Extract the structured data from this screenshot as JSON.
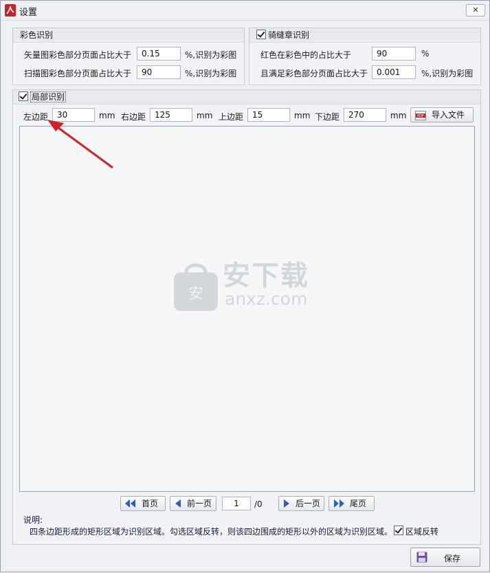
{
  "window": {
    "title": "设置",
    "close_label": "✕"
  },
  "color_recognition": {
    "header": "彩色识别",
    "vector_label": "矢量图彩色部分页面占比大于",
    "vector_value": "0.15",
    "vector_suffix": "%,识别为彩图",
    "scan_label": "扫描图彩色部分页面占比大于",
    "scan_value": "90",
    "scan_suffix": "%,识别为彩图"
  },
  "seal_recognition": {
    "header": "骑缝章识别",
    "red_label": "红色在彩色中的占比大于",
    "red_value": "90",
    "red_suffix": "%",
    "color_label": "且满足彩色部分页面占比大于",
    "color_value": "0.001",
    "color_suffix": "%,识别为彩图"
  },
  "local_recognition": {
    "header": "局部识别",
    "left_label": "左边距",
    "left_value": "30",
    "right_label": "右边距",
    "right_value": "125",
    "top_label": "上边距",
    "top_value": "15",
    "bottom_label": "下边距",
    "bottom_value": "270",
    "unit": "mm",
    "import_label": "导入文件"
  },
  "watermark": {
    "text": "安下载",
    "url": "anxz.com",
    "badge": "安"
  },
  "pager": {
    "first": "首页",
    "prev": "前一页",
    "page_value": "1",
    "total": "/0",
    "next": "后一页",
    "last": "尾页"
  },
  "note": {
    "title": "说明:",
    "text": "四条边距形成的矩形区域为识别区域。勾选区域反转，则该四边围成的矩形以外的区域为识别区域。",
    "invert_label": "区域反转"
  },
  "save_label": "保存",
  "colors": {
    "accent_blue": "#2a5fb8",
    "arrow_red": "#d42020",
    "pdf_red": "#c0262b"
  }
}
